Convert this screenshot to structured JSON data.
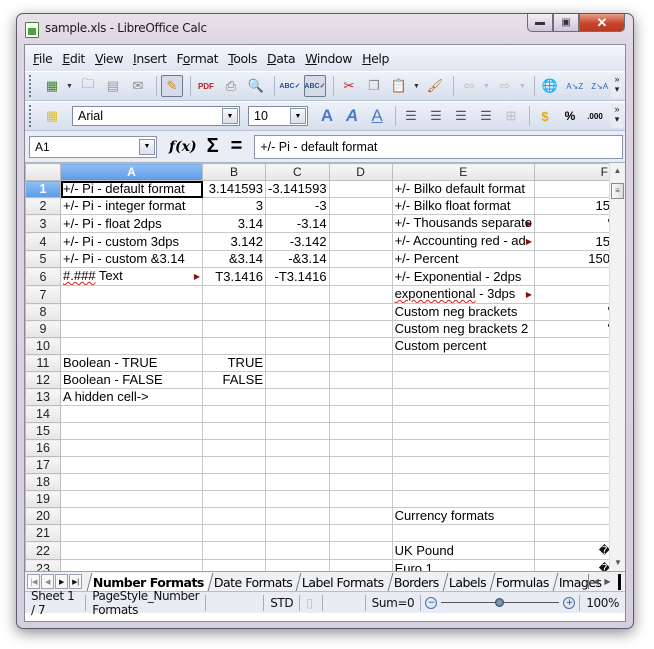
{
  "window": {
    "title": "sample.xls - LibreOffice Calc",
    "buttons": [
      "minimize",
      "maximize",
      "close"
    ]
  },
  "menu": [
    {
      "label": "File",
      "mnemonic": "F"
    },
    {
      "label": "Edit",
      "mnemonic": "E"
    },
    {
      "label": "View",
      "mnemonic": "V"
    },
    {
      "label": "Insert",
      "mnemonic": "I"
    },
    {
      "label": "Format",
      "mnemonic": "o"
    },
    {
      "label": "Tools",
      "mnemonic": "T"
    },
    {
      "label": "Data",
      "mnemonic": "D"
    },
    {
      "label": "Window",
      "mnemonic": "W"
    },
    {
      "label": "Help",
      "mnemonic": "H"
    }
  ],
  "standard_toolbar": [
    "new-spreadsheet-icon",
    "open-icon",
    "save-icon",
    "email-icon",
    "edit-file-icon",
    "export-pdf-icon",
    "print-icon",
    "print-preview-icon",
    "spellcheck-icon",
    "autospellcheck-icon",
    "cut-icon",
    "copy-icon",
    "paste-icon",
    "clone-format-icon",
    "undo-icon",
    "redo-icon",
    "navigator-icon",
    "sort-ascending-icon",
    "sort-descending-icon"
  ],
  "format_toolbar": {
    "font_name": "Arial",
    "font_size": "10",
    "icons": [
      "styles-icon",
      "bold-icon",
      "italic-icon",
      "underline-icon",
      "align-left-icon",
      "align-center-icon",
      "align-right-icon",
      "justify-icon",
      "merge-cells-icon",
      "currency-icon",
      "percent-icon",
      "add-decimal-icon"
    ]
  },
  "formula_bar": {
    "name_box": "A1",
    "function_wizard": "f(x)",
    "sum": "Σ",
    "equals": "=",
    "content": "+/- Pi - default format"
  },
  "grid": {
    "columns": [
      "A",
      "B",
      "C",
      "D",
      "E",
      "F"
    ],
    "selected_cell": "A1",
    "rows": [
      {
        "n": "1",
        "A": "+/- Pi - default format",
        "B": "3.141593",
        "C": "-3.141593",
        "D": "",
        "E": "+/- Bilko default format",
        "F": ""
      },
      {
        "n": "2",
        "A": "+/- Pi - integer format",
        "B": "3",
        "C": "-3",
        "D": "",
        "E": "+/- Bilko float format",
        "F": "15"
      },
      {
        "n": "3",
        "A": "+/- Pi - float 2dps",
        "B": "3.14",
        "C": "-3.14",
        "D": "",
        "E": "+/- Thousands separato",
        "F": "'"
      },
      {
        "n": "4",
        "A": "+/- Pi - custom 3dps",
        "B": "3.142",
        "C": "-3.142",
        "D": "",
        "E": "+/- Accounting red - ad",
        "F": "15"
      },
      {
        "n": "5",
        "A": "+/- Pi - custom &3.14",
        "B": "&3.14",
        "C": "-&3.14",
        "D": "",
        "E": "+/- Percent",
        "F": "150"
      },
      {
        "n": "6",
        "A": "#.### Text",
        "B": "T3.1416",
        "C": "-T3.1416",
        "D": "",
        "E": "+/- Exponential - 2dps",
        "F": ""
      },
      {
        "n": "7",
        "A": "",
        "B": "",
        "C": "",
        "D": "",
        "E": "exponentional - 3dps",
        "F": ""
      },
      {
        "n": "8",
        "A": "",
        "B": "",
        "C": "",
        "D": "",
        "E": "Custom neg brackets",
        "F": "'"
      },
      {
        "n": "9",
        "A": "",
        "B": "",
        "C": "",
        "D": "",
        "E": "Custom neg brackets 2",
        "F": "'"
      },
      {
        "n": "10",
        "A": "",
        "B": "",
        "C": "",
        "D": "",
        "E": "Custom percent",
        "F": ""
      },
      {
        "n": "11",
        "A": "Boolean - TRUE",
        "B": "TRUE",
        "C": "",
        "D": "",
        "E": "",
        "F": ""
      },
      {
        "n": "12",
        "A": "Boolean - FALSE",
        "B": "FALSE",
        "C": "",
        "D": "",
        "E": "",
        "F": ""
      },
      {
        "n": "13",
        "A": "A hidden cell->",
        "B": "",
        "C": "",
        "D": "",
        "E": "",
        "F": ""
      },
      {
        "n": "14",
        "A": "",
        "B": "",
        "C": "",
        "D": "",
        "E": "",
        "F": ""
      },
      {
        "n": "15",
        "A": "",
        "B": "",
        "C": "",
        "D": "",
        "E": "",
        "F": ""
      },
      {
        "n": "16",
        "A": "",
        "B": "",
        "C": "",
        "D": "",
        "E": "",
        "F": ""
      },
      {
        "n": "17",
        "A": "",
        "B": "",
        "C": "",
        "D": "",
        "E": "",
        "F": ""
      },
      {
        "n": "18",
        "A": "",
        "B": "",
        "C": "",
        "D": "",
        "E": "",
        "F": ""
      },
      {
        "n": "19",
        "A": "",
        "B": "",
        "C": "",
        "D": "",
        "E": "",
        "F": ""
      },
      {
        "n": "20",
        "A": "",
        "B": "",
        "C": "",
        "D": "",
        "E": "Currency formats",
        "F": ""
      },
      {
        "n": "21",
        "A": "",
        "B": "",
        "C": "",
        "D": "",
        "E": "",
        "F": ""
      },
      {
        "n": "22",
        "A": "",
        "B": "",
        "C": "",
        "D": "",
        "E": "UK Pound",
        "F": "�"
      },
      {
        "n": "23",
        "A": "",
        "B": "",
        "C": "",
        "D": "",
        "E": "Euro 1",
        "F": "�"
      }
    ],
    "overflow_rows": [
      "6",
      "3",
      "4",
      "7"
    ],
    "spell_underlined": {
      "A6": "#.###",
      "E1": "Bilko",
      "E2": "Bilko",
      "E7": "exponentional"
    }
  },
  "sheet_tabs": {
    "active": "Number Formats",
    "tabs": [
      "Number Formats",
      "Date Formats",
      "Label Formats",
      "Borders",
      "Labels",
      "Formulas",
      "Images"
    ]
  },
  "status_bar": {
    "sheet": "Sheet 1 / 7",
    "page_style": "PageStyle_Number Formats",
    "mode": "STD",
    "sum": "Sum=0",
    "zoom": "100%"
  }
}
